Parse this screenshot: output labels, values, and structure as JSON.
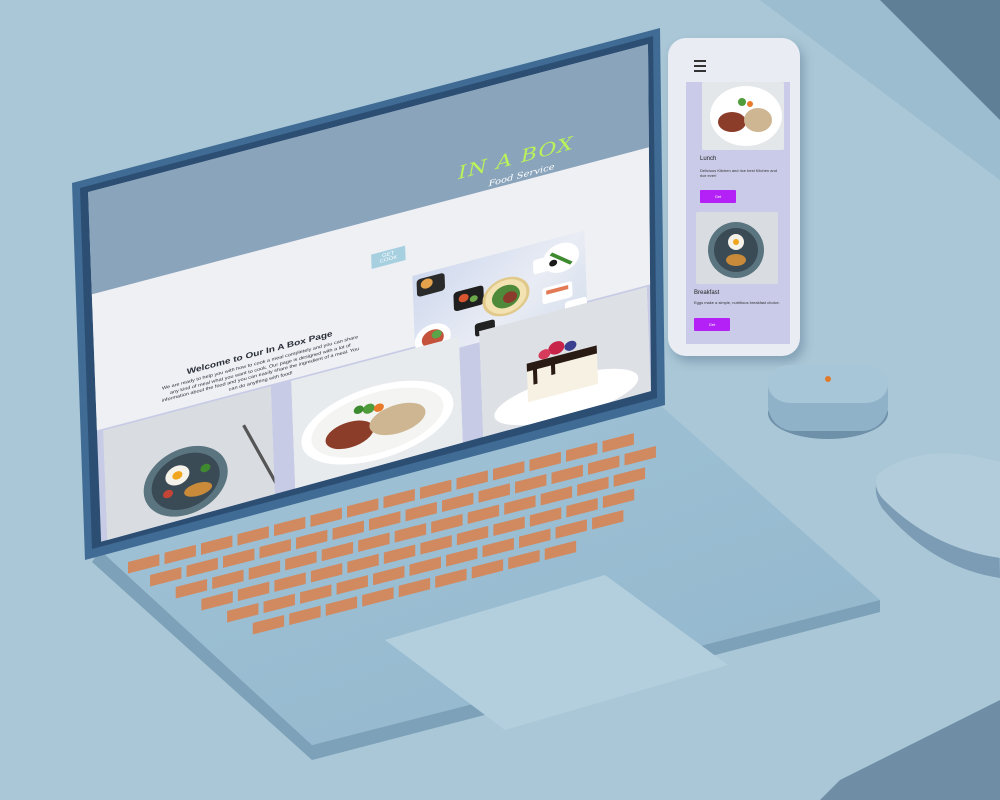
{
  "site": {
    "logo": "IN A BOX",
    "tagline": "Food Service",
    "cook_button": "GET COOK",
    "welcome_title": "Welcome to Our In A Box Page",
    "welcome_text": "We are ready to help you with how to cook a meal completely and you can share any kind of meal what you want to cook. Our page is designed with a lot of information about the food and you can easily share the ingredient of a meal. You can do anything with food!"
  },
  "phone": {
    "cards": [
      {
        "title": "Lunch",
        "text": "Delicious Kitchen and rice best Kitchen and rice ever!",
        "button": "Get"
      },
      {
        "title": "Breakfast",
        "text": "Eggs make a simple, nutritious breakfast choice.",
        "button": "Get"
      }
    ]
  },
  "colors": {
    "logo": "#b9f25a",
    "header_bg": "#8aa4bb",
    "hero_bg": "#eef0f3",
    "section_bg": "#c7cbe6",
    "phone_button": "#b321f6",
    "keycap": "#d18a5f",
    "laptop_body": "#9bbed3",
    "desk": "#a9c7d6"
  },
  "icons": {
    "phone_menu": "hamburger-icon"
  }
}
